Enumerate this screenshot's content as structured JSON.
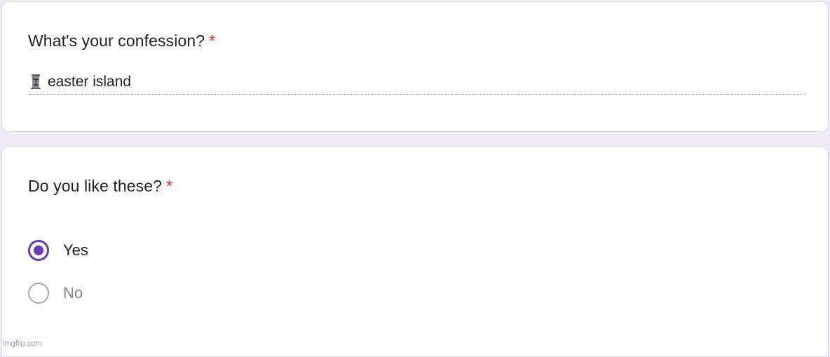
{
  "question1": {
    "title": "What's your confession?",
    "required_mark": "*",
    "answer_text": "easter island",
    "answer_emoji_icon": "moai-icon"
  },
  "question2": {
    "title": "Do you like these?",
    "required_mark": "*",
    "options": [
      {
        "label": "Yes",
        "selected": true
      },
      {
        "label": "No",
        "selected": false
      }
    ]
  },
  "colors": {
    "background": "#f0ebf8",
    "accent": "#673ab7",
    "required": "#d93025"
  },
  "watermark": "imgflip.com"
}
